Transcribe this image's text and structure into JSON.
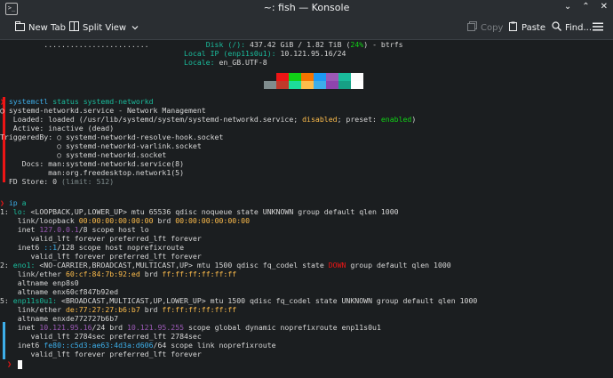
{
  "window": {
    "title": "~: fish — Konsole",
    "app_icon": ">_",
    "controls": [
      "⌄",
      "⌃",
      "✕"
    ]
  },
  "toolbar": {
    "new_tab": "New Tab",
    "split_view": "Split View",
    "copy": "Copy",
    "paste": "Paste",
    "find": "Find..."
  },
  "sysinfo": {
    "dots": "........................",
    "disk_label": "Disk (/):",
    "disk_used": "437.42 GiB / 1.82 TiB",
    "disk_open": "(",
    "disk_pct": "24%",
    "disk_close": ")",
    "disk_fs": "- btrfs",
    "local_ip_label": "Local IP (enp11s0u1):",
    "local_ip": "10.121.95.16/24",
    "locale_label": "Locale:",
    "locale": "en_GB.UTF-8"
  },
  "palette": {
    "row1": [
      "#1b1e20",
      "#ed1515",
      "#11d116",
      "#f67400",
      "#1d99f3",
      "#9b59b6",
      "#1abc9c",
      "#fcfcfc"
    ],
    "row2": [
      "#7f8c8d",
      "#c0392b",
      "#1cdc9a",
      "#fdbc4b",
      "#3daee9",
      "#8e44ad",
      "#16a085",
      "#ffffff"
    ]
  },
  "lines": {
    "l1_cmd": "systemctl",
    "l1_arg1": "status",
    "l1_arg2": "systemd-networkd",
    "l2": "systemd-networkd.service - Network Management",
    "l3_a": "   Loaded: loaded (/usr/lib/systemd/system/systemd-networkd.service; ",
    "l3_dis": "disabled",
    "l3_b": "; preset: ",
    "l3_en": "enabled",
    "l3_c": ")",
    "l4": "   Active: inactive (dead)",
    "l5": "TriggeredBy: ○ systemd-networkd-resolve-hook.socket",
    "l6": "             ○ systemd-networkd-varlink.socket",
    "l7": "             ○ systemd-networkd.socket",
    "l8": "     Docs: man:systemd-networkd.service(8)",
    "l9": "           man:org.freedesktop.network1(5)",
    "l10_a": "  FD Store: 0 ",
    "l10_b": "(limit: 512)",
    "ip_cmd": "ip",
    "ip_arg": "a",
    "i1_a": "1: ",
    "i1_b": "lo:",
    "i1_c": " <LOOPBACK,UP,LOWER_UP> mtu 65536 qdisc noqueue state UNKNOWN group default qlen 1000",
    "i2_a": "    link/loopback ",
    "i2_b": "00:00:00:00:00:00",
    "i2_c": " brd ",
    "i2_d": "00:00:00:00:00:00",
    "i3_a": "    inet ",
    "i3_b": "127.0.0.1",
    "i3_c": "/8 scope host lo",
    "i4": "       valid_lft forever preferred_lft forever",
    "i5_a": "    inet6 ",
    "i5_b": "::1",
    "i5_c": "/128 scope host noprefixroute",
    "i6": "       valid_lft forever preferred_lft forever",
    "i7_a": "2: ",
    "i7_b": "eno1:",
    "i7_c": " <NO-CARRIER,BROADCAST,MULTICAST,UP> mtu 1500 qdisc fq_codel state ",
    "i7_d": "DOWN",
    "i7_e": " group default qlen 1000",
    "i8_a": "    link/ether ",
    "i8_b": "60:cf:84:7b:92:ed",
    "i8_c": " brd ",
    "i8_d": "ff:ff:ff:ff:ff:ff",
    "i9": "    altname enp8s0",
    "i10": "    altname enx60cf847b92ed",
    "i11_a": "5: ",
    "i11_b": "enp11s0u1:",
    "i11_c": " <BROADCAST,MULTICAST,UP,LOWER_UP> mtu 1500 qdisc fq_codel state UNKNOWN group default qlen 1000",
    "i12_a": "    link/ether ",
    "i12_b": "de:77:27:27:b6:b7",
    "i12_c": " brd ",
    "i12_d": "ff:ff:ff:ff:ff:ff",
    "i13": "    altname enxde772727b6b7",
    "i14_a": "    inet ",
    "i14_b": "10.121.95.16",
    "i14_c": "/24 brd ",
    "i14_d": "10.121.95.255",
    "i14_e": " scope global dynamic noprefixroute enp11s0u1",
    "i15": "       valid_lft 2784sec preferred_lft 2784sec",
    "i16_a": "    inet6 ",
    "i16_b": "fe80::c5d3:ae63:4d3a:d606",
    "i16_c": "/64 scope link noprefixroute",
    "i17": "       valid_lft forever preferred_lft forever"
  }
}
